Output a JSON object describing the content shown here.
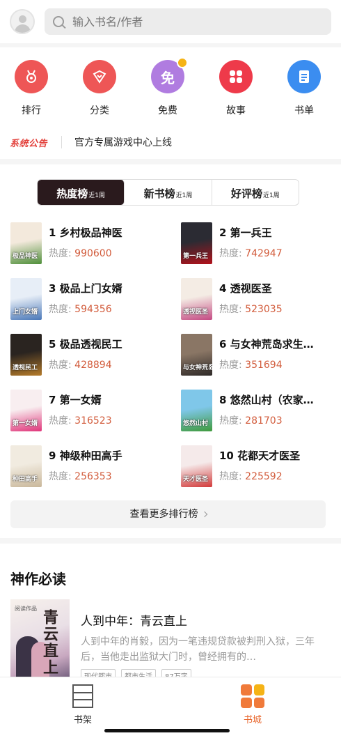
{
  "search": {
    "placeholder": "输入书名/作者"
  },
  "categories": [
    {
      "label": "排行",
      "icon": "medal-icon",
      "color": "#ee5656"
    },
    {
      "label": "分类",
      "icon": "heart-box-icon",
      "color": "#ee5656"
    },
    {
      "label": "免费",
      "icon_text": "免",
      "icon": "free-icon",
      "color": "#b07ce0"
    },
    {
      "label": "故事",
      "icon": "grid-icon",
      "color": "#ee3a4a"
    },
    {
      "label": "书单",
      "icon": "list-icon",
      "color": "#3b8df0"
    }
  ],
  "notice": {
    "tag": "系统公告",
    "text": "官方专属游戏中心上线"
  },
  "rank_tabs": [
    {
      "label": "热度榜",
      "sub": "近1周",
      "active": true
    },
    {
      "label": "新书榜",
      "sub": "近1周",
      "active": false
    },
    {
      "label": "好评榜",
      "sub": "近1周",
      "active": false
    }
  ],
  "heat_label": "热度:",
  "books": [
    {
      "title": "1 乡村极品神医",
      "heat": "990600",
      "cover_text": "极品神医",
      "cover_colors": [
        "#f3e9dc",
        "#4f8f3a"
      ]
    },
    {
      "title": "2 第一兵王",
      "heat": "742947",
      "cover_text": "第一兵王",
      "cover_colors": [
        "#2b2b33",
        "#b3121b"
      ]
    },
    {
      "title": "3 极品上门女婿",
      "heat": "594356",
      "cover_text": "上门女婿",
      "cover_colors": [
        "#e7eef7",
        "#4a78b8"
      ]
    },
    {
      "title": "4 透视医圣",
      "heat": "523035",
      "cover_text": "透视医圣",
      "cover_colors": [
        "#f4ece4",
        "#c44a83"
      ]
    },
    {
      "title": "5 极品透视民工",
      "heat": "428894",
      "cover_text": "透视民工",
      "cover_colors": [
        "#2a2420",
        "#b57b2a"
      ]
    },
    {
      "title": "6 与女神荒岛求生…",
      "heat": "351694",
      "cover_text": "与女神荒岛",
      "cover_colors": [
        "#8a7665",
        "#2f2a28"
      ]
    },
    {
      "title": "7 第一女婿",
      "heat": "316523",
      "cover_text": "第一女婿",
      "cover_colors": [
        "#f8eef0",
        "#e0357a"
      ]
    },
    {
      "title": "8 悠然山村（农家…",
      "heat": "281703",
      "cover_text": "悠然山村",
      "cover_colors": [
        "#7fc7e9",
        "#3f9a3c"
      ]
    },
    {
      "title": "9 神级种田高手",
      "heat": "256353",
      "cover_text": "种田高手",
      "cover_colors": [
        "#f1ebe0",
        "#c9b79a"
      ]
    },
    {
      "title": "10 花都天才医圣",
      "heat": "225592",
      "cover_text": "天才医圣",
      "cover_colors": [
        "#f5eaea",
        "#d23a3a"
      ]
    }
  ],
  "more_button": "查看更多排行榜",
  "must_read": {
    "section_title": "神作必读",
    "cover_title": "青云直上",
    "cover_publisher": "阅读作品",
    "name": "人到中年：青云直上",
    "desc": "人到中年的肖毅，因为一笔违规贷款被判刑入狱，三年后，当他走出监狱大门时，曾经拥有的…",
    "tags": [
      "现代都市",
      "都市生活",
      "87万字"
    ]
  },
  "nav": [
    {
      "label": "书架",
      "icon": "bookshelf-icon",
      "active": false
    },
    {
      "label": "书城",
      "icon": "bookstore-icon",
      "active": true
    }
  ]
}
